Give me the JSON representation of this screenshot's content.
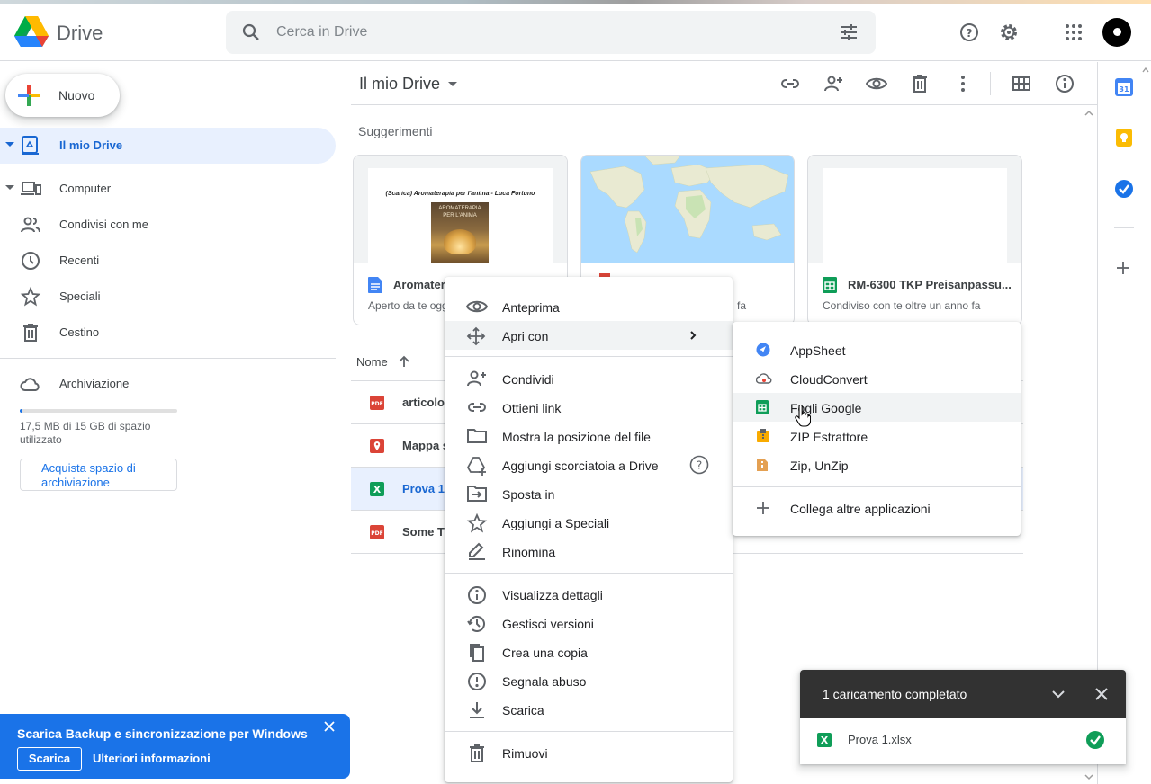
{
  "app": {
    "name": "Drive"
  },
  "search": {
    "placeholder": "Cerca in Drive"
  },
  "sidebar": {
    "new_label": "Nuovo",
    "items": [
      {
        "label": "Il mio Drive",
        "icon": "drive-icon",
        "active": true
      },
      {
        "label": "Computer",
        "icon": "computer-icon"
      },
      {
        "label": "Condivisi con me",
        "icon": "people-icon"
      },
      {
        "label": "Recenti",
        "icon": "clock-icon"
      },
      {
        "label": "Speciali",
        "icon": "star-icon"
      },
      {
        "label": "Cestino",
        "icon": "trash-icon"
      }
    ],
    "storage": {
      "label": "Archiviazione",
      "used_fraction": 0.01,
      "text": "17,5 MB di 15 GB di spazio utilizzato",
      "buy_label": "Acquista spazio di archiviazione"
    }
  },
  "main": {
    "title": "Il mio Drive",
    "suggestions_title": "Suggerimenti",
    "cards": [
      {
        "name": "Aromatera",
        "sub": "Aperto da te ogg",
        "thumb_text": "(Scarica) Aromaterapia per l'anima - Luca Fortuno",
        "cover_text": "AROMATERAPIA PER L'ANIMA",
        "icon": "docs-icon"
      },
      {
        "name": "",
        "sub": "fa",
        "icon": "map-pin-icon"
      },
      {
        "name": "RM-6300 TKP Preisanpassu...",
        "sub": "Condiviso con te oltre un anno fa",
        "icon": "sheets-icon"
      }
    ],
    "list_header": {
      "name": "Nome"
    },
    "files": [
      {
        "name": "articolo.",
        "icon": "pdf-icon"
      },
      {
        "name": "Mappa s",
        "icon": "map-pin-icon"
      },
      {
        "name": "Prova 1.",
        "icon": "excel-icon",
        "selected": true
      },
      {
        "name": "Some Tr",
        "icon": "pdf-icon"
      }
    ]
  },
  "context_menu": {
    "items": [
      {
        "label": "Anteprima",
        "icon": "eye-icon"
      },
      {
        "label": "Apri con",
        "icon": "move-icon",
        "submenu": true
      },
      {
        "label": "Condividi",
        "icon": "person-add-icon"
      },
      {
        "label": "Ottieni link",
        "icon": "link-icon"
      },
      {
        "label": "Mostra la posizione del file",
        "icon": "folder-icon"
      },
      {
        "label": "Aggiungi scorciatoia a Drive",
        "icon": "drive-add-icon",
        "help": true
      },
      {
        "label": "Sposta in",
        "icon": "move-to-icon"
      },
      {
        "label": "Aggiungi a Speciali",
        "icon": "star-icon"
      },
      {
        "label": "Rinomina",
        "icon": "edit-icon"
      },
      {
        "label": "Visualizza dettagli",
        "icon": "info-icon"
      },
      {
        "label": "Gestisci versioni",
        "icon": "history-icon"
      },
      {
        "label": "Crea una copia",
        "icon": "copy-icon"
      },
      {
        "label": "Segnala abuso",
        "icon": "report-icon"
      },
      {
        "label": "Scarica",
        "icon": "download-icon"
      },
      {
        "label": "Rimuovi",
        "icon": "trash-icon"
      }
    ]
  },
  "open_with": {
    "apps": [
      {
        "label": "AppSheet",
        "icon": "appsheet-icon"
      },
      {
        "label": "CloudConvert",
        "icon": "cloudconvert-icon"
      },
      {
        "label": "Fogli Google",
        "icon": "sheets-icon"
      },
      {
        "label": "ZIP Estrattore",
        "icon": "zip-icon"
      },
      {
        "label": "Zip, UnZip",
        "icon": "zip-unzip-icon"
      }
    ],
    "connect_label": "Collega altre applicazioni"
  },
  "banner": {
    "title": "Scarica Backup e sincronizzazione per Windows",
    "download_label": "Scarica",
    "info_label": "Ulteriori informazioni"
  },
  "upload_panel": {
    "title": "1 caricamento completato",
    "file_name": "Prova 1.xlsx"
  },
  "colors": {
    "accent": "#1a73e8",
    "active_bg": "#e8f0fe",
    "sheets_green": "#0f9d58",
    "pdf_red": "#db4437"
  }
}
